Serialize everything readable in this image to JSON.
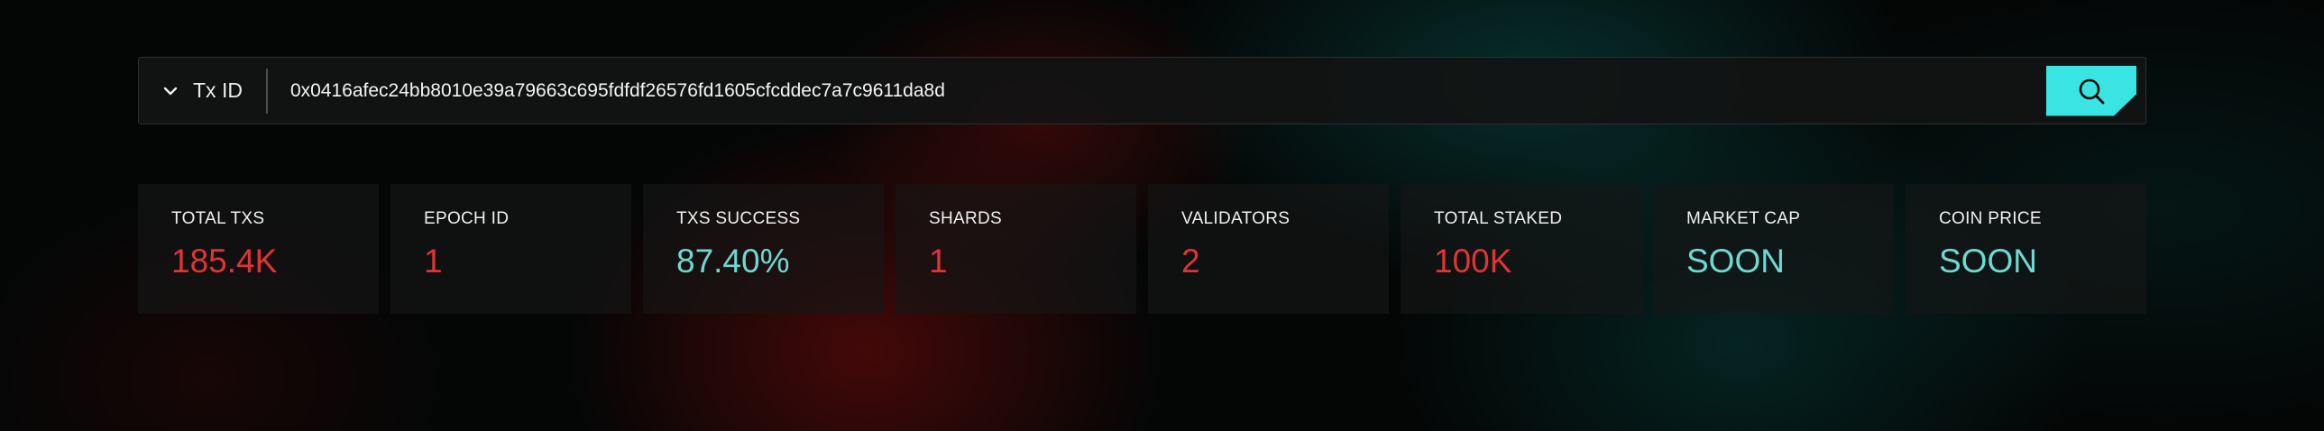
{
  "search": {
    "type_label": "Tx ID",
    "value": "0x0416afec24bb8010e39a79663c695fdfdf26576fd1605cfcddec7a7c9611da8d",
    "icon": "search-icon"
  },
  "colors": {
    "accent_cyan": "#39e4e2",
    "value_red": "#e03434",
    "value_teal": "#6fd8d1"
  },
  "stats": [
    {
      "label": "TOTAL TXS",
      "value": "185.4K",
      "color": "#e03434"
    },
    {
      "label": "EPOCH ID",
      "value": "1",
      "color": "#e03434"
    },
    {
      "label": "TXS SUCCESS",
      "value": "87.40%",
      "color": "#6fd8d1"
    },
    {
      "label": "SHARDS",
      "value": "1",
      "color": "#e03434"
    },
    {
      "label": "VALIDATORS",
      "value": "2",
      "color": "#e03434"
    },
    {
      "label": "TOTAL STAKED",
      "value": "100K",
      "color": "#e03434"
    },
    {
      "label": "MARKET CAP",
      "value": "SOON",
      "color": "#6fd8d1"
    },
    {
      "label": "COIN PRICE",
      "value": "SOON",
      "color": "#6fd8d1"
    }
  ]
}
